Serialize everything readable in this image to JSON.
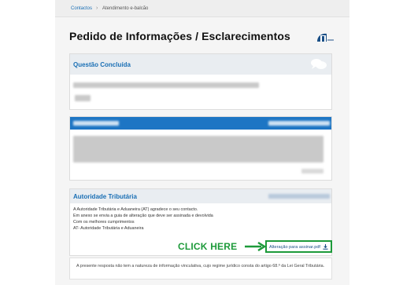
{
  "breadcrumb": {
    "link": "Contactos",
    "separator": "›",
    "current": "Atendimento e-balcão"
  },
  "page_title": "Pedido de Informações / Esclarecimentos",
  "status_card": {
    "title": "Questão Concluída",
    "icon": "chat-bubbles-icon"
  },
  "reply_card": {
    "title": "Autoridade Tributária",
    "body_lines": [
      "A Autoridade Tributária e Aduaneira (AT) agradece o seu contacto.",
      "Em anexo se envia a guia de alteração que deve ser assinada e devolvida",
      "Com os melhores cumprimentos",
      "AT- Autoridade Tributária e Aduaneira"
    ],
    "pdf_link_label": "Alteração para assinar.pdf",
    "download_icon": "download-icon"
  },
  "annotation": {
    "label": "CLICK HERE",
    "color": "#1d9a3a"
  },
  "note": {
    "text": "A presente resposta não tem a natureza de informação vinculativa, cujo regime jurídico consta do artigo 68.º da Lei Geral Tributária."
  },
  "colors": {
    "accent": "#1a6fb5",
    "header_blue": "#1d75c4",
    "highlight_green": "#1d9a3a"
  }
}
